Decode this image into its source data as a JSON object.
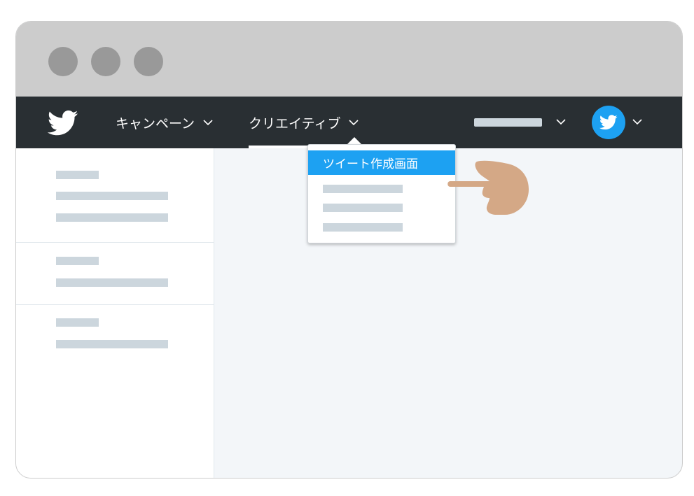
{
  "nav": {
    "logo_icon": "twitter-bird-icon",
    "items": [
      {
        "label": "キャンペーン"
      },
      {
        "label": "クリエイティブ",
        "active": true
      }
    ],
    "avatar_icon": "twitter-bird-icon"
  },
  "dropdown": {
    "selected_label": "ツイート作成画面"
  },
  "colors": {
    "brand_blue": "#1da1f2",
    "navbar": "#292f33",
    "titlebar": "#cccccc",
    "placeholder": "#ccd6dd",
    "content_bg": "#f3f6f9",
    "hand": "#d4a886"
  }
}
